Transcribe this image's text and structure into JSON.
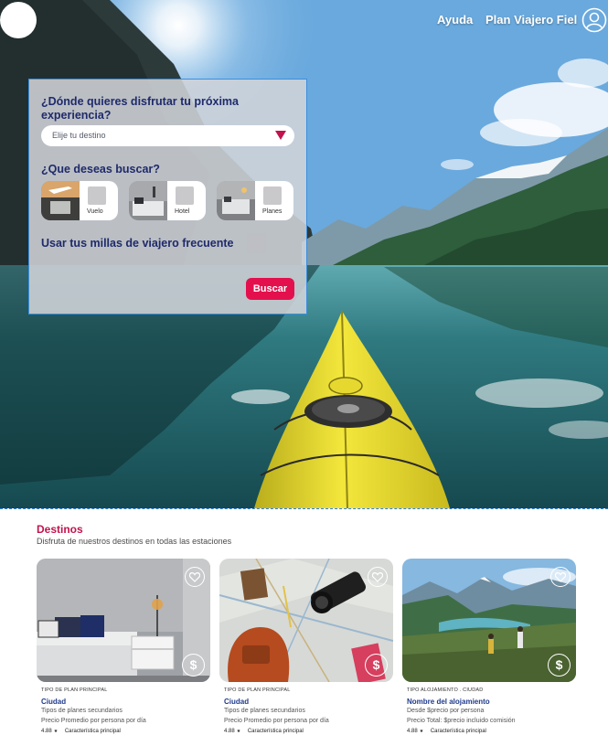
{
  "header": {
    "nav": [
      {
        "label": "Ayuda"
      },
      {
        "label": "Plan Viajero Fiel"
      }
    ]
  },
  "search": {
    "question_destination": "¿Dónde quieres disfrutar tu próxima experiencia?",
    "destination_placeholder": "Elije tu destino",
    "question_type": "¿Que deseas buscar?",
    "options": [
      {
        "label": "Vuelo",
        "icon": "plane-thumb",
        "checked": false
      },
      {
        "label": "Hotel",
        "icon": "bed-thumb",
        "checked": false
      },
      {
        "label": "Planes",
        "icon": "room-thumb",
        "checked": false
      }
    ],
    "miles_label": "Usar tus millas de viajero frecuente",
    "miles_checked": false,
    "submit_label": "Buscar"
  },
  "destinos": {
    "title": "Destinos",
    "subtitle": "Disfruta de nuestros destinos  en todas las estaciones",
    "cards": [
      {
        "type": "TIPO DE PLAN PRINCIPAL",
        "name": "Ciudad",
        "line1": "Tipos de planes secundarios",
        "line2": "Precio Promedio por persona por día",
        "rating": "4.88",
        "feature": "Característica principal",
        "price_icon": "$"
      },
      {
        "type": "TIPO DE PLAN PRINCIPAL",
        "name": "Ciudad",
        "line1": "Tipos de planes secundarios",
        "line2": "Precio Promedio por persona por día",
        "rating": "4.88",
        "feature": "Característica principal",
        "price_icon": "$"
      },
      {
        "type": "TIPO ALOJAMIENTO . CIUDAD",
        "name": "Nombre del alojamiento",
        "line1": "Desde $precio por persona",
        "line2": "Precio Total: $precio incluido comisión",
        "rating": "4.88",
        "feature": "Característica principal",
        "price_icon": "$"
      }
    ]
  },
  "colors": {
    "accent": "#c1134d",
    "button": "#e3104d",
    "link_blue": "#1f3a8c",
    "panel_border": "#3b8fe0"
  }
}
